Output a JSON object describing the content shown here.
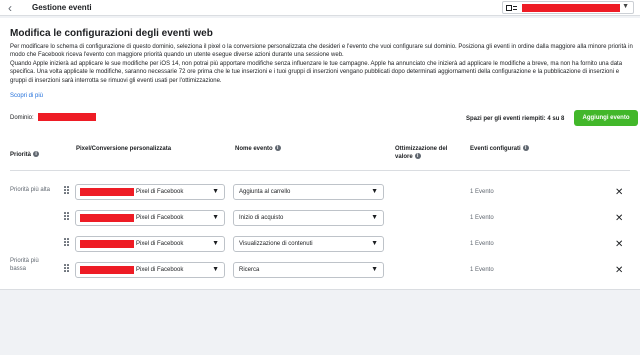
{
  "header": {
    "back_icon": "chevron-left-icon",
    "title": "Gestione eventi",
    "account_icon": "business-icon"
  },
  "main": {
    "title": "Modifica le configurazioni degli eventi web",
    "description_1": "Per modificare lo schema di configurazione di questo dominio, seleziona il pixel o la conversione personalizzata che desideri e l'evento che vuoi configurare sul dominio. Posiziona gli eventi in ordine dalla maggiore alla minore priorità in modo che Facebook riceva l'evento con maggiore priorità quando un utente esegue diverse azioni durante una sessione web.",
    "description_2": "Quando Apple inizierà ad applicare le sue modifiche per iOS 14, non potrai più apportare modifiche senza influenzare le tue campagne. Apple ha annunciato che inizierà ad applicare le modifiche a breve, ma non ha fornito una data specifica. Una volta applicate le modifiche, saranno necessarie 72 ore prima che le tue inserzioni e i tuoi gruppi di inserzioni vengano pubblicati dopo determinati aggiornamenti della configurazione e la pubblicazione di inserzioni e gruppi di inserzioni sarà interrotta se rimuovi gli eventi usati per l'ottimizzazione.",
    "learn_more": "Scopri di più",
    "domain_label": "Dominio:",
    "slots_text": "Spazi per gli eventi riempiti: 4 su 8",
    "add_button": "Aggiungi evento"
  },
  "table": {
    "headers": {
      "priority": "Priorità",
      "pixel": "Pixel/Conversione personalizzata",
      "event": "Nome evento",
      "optimization": "Ottimizzazione del valore",
      "configured": "Eventi configurati"
    },
    "priority_high": "Priorità più alta",
    "priority_low": "Priorità più bassa",
    "rows": [
      {
        "pixel": "Pixel di Facebook",
        "event": "Aggiunta al carrello",
        "configured": "1 Evento"
      },
      {
        "pixel": "Pixel di Facebook",
        "event": "Inizio di acquisto",
        "configured": "1 Evento"
      },
      {
        "pixel": "Pixel di Facebook",
        "event": "Visualizzazione di contenuti",
        "configured": "1 Evento"
      },
      {
        "pixel": "Pixel di Facebook",
        "event": "Ricerca",
        "configured": "1 Evento"
      }
    ]
  },
  "colors": {
    "primary_green": "#42b72a",
    "link_blue": "#216fdb",
    "redaction": "#ee1c25"
  }
}
